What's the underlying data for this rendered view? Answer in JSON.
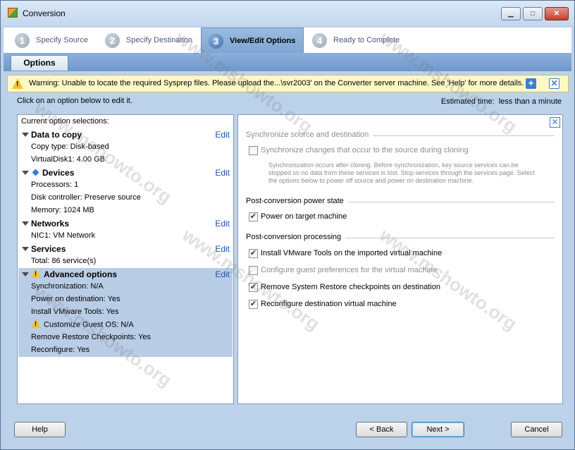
{
  "window": {
    "title": "Conversion",
    "min_label": "▁",
    "max_label": "□",
    "close_label": "✕"
  },
  "wizard": {
    "steps": [
      {
        "num": "1",
        "label": "Specify Source"
      },
      {
        "num": "2",
        "label": "Specify Destination"
      },
      {
        "num": "3",
        "label": "View/Edit Options"
      },
      {
        "num": "4",
        "label": "Ready to Complete"
      }
    ],
    "active_step": 3
  },
  "subtab": {
    "label": "Options"
  },
  "warning": {
    "text": "Warning: Unable to locate the required Sysprep files. Please upload the...\\svr2003' on the Converter server machine. See 'Help' for more details.",
    "plus": "+",
    "close": "✕"
  },
  "hint": "Click on an option below to edit it.",
  "estimate": {
    "label": "Estimated time:",
    "value": "less than a minute"
  },
  "left": {
    "title": "Current option selections:",
    "edit_label": "Edit",
    "sections": [
      {
        "title": "Data to copy",
        "items": [
          "Copy type: Disk-based",
          "VirtualDisk1: 4.00 GB"
        ]
      },
      {
        "title": "Devices",
        "items": [
          "Processors: 1",
          "Disk controller: Preserve source",
          "Memory: 1024 MB"
        ]
      },
      {
        "title": "Networks",
        "items": [
          "NIC1: VM Network"
        ]
      },
      {
        "title": "Services",
        "items": [
          "Total: 86 service(s)"
        ]
      },
      {
        "title": "Advanced options",
        "items": [
          "Synchronization: N/A",
          "Power on destination: Yes",
          "Install VMware Tools: Yes",
          "Customize Guest OS: N/A",
          "Remove Restore Checkpoints: Yes",
          "Reconfigure: Yes"
        ]
      }
    ]
  },
  "right": {
    "close": "✕",
    "sync": {
      "group_label": "Synchronize source and destination",
      "checkbox": "Synchronize changes that occur to the source during cloning",
      "description": "Synchronization occurs after cloning. Before synchronization, key source services can be stopped so no data from these services is lost. Stop services through the services page. Select the options below to power off source and power on destination machine."
    },
    "power": {
      "group_label": "Post-conversion power state",
      "checkbox": "Power on target machine"
    },
    "processing": {
      "group_label": "Post-conversion processing",
      "items": [
        {
          "label": "Install VMware Tools on the imported virtual machine",
          "checked": true
        },
        {
          "label": "Configure guest preferences for the virtual machine",
          "checked": false
        },
        {
          "label": "Remove System Restore checkpoints on destination",
          "checked": true
        },
        {
          "label": "Reconfigure destination virtual machine",
          "checked": true
        }
      ]
    }
  },
  "buttons": {
    "help": "Help",
    "back": "< Back",
    "next": "Next >",
    "cancel": "Cancel"
  },
  "watermark": "www.mshowto.org",
  "colors": {
    "accent": "#3f7dd1",
    "selection": "#b9cde6",
    "warning_bg": "#fff8c4"
  }
}
